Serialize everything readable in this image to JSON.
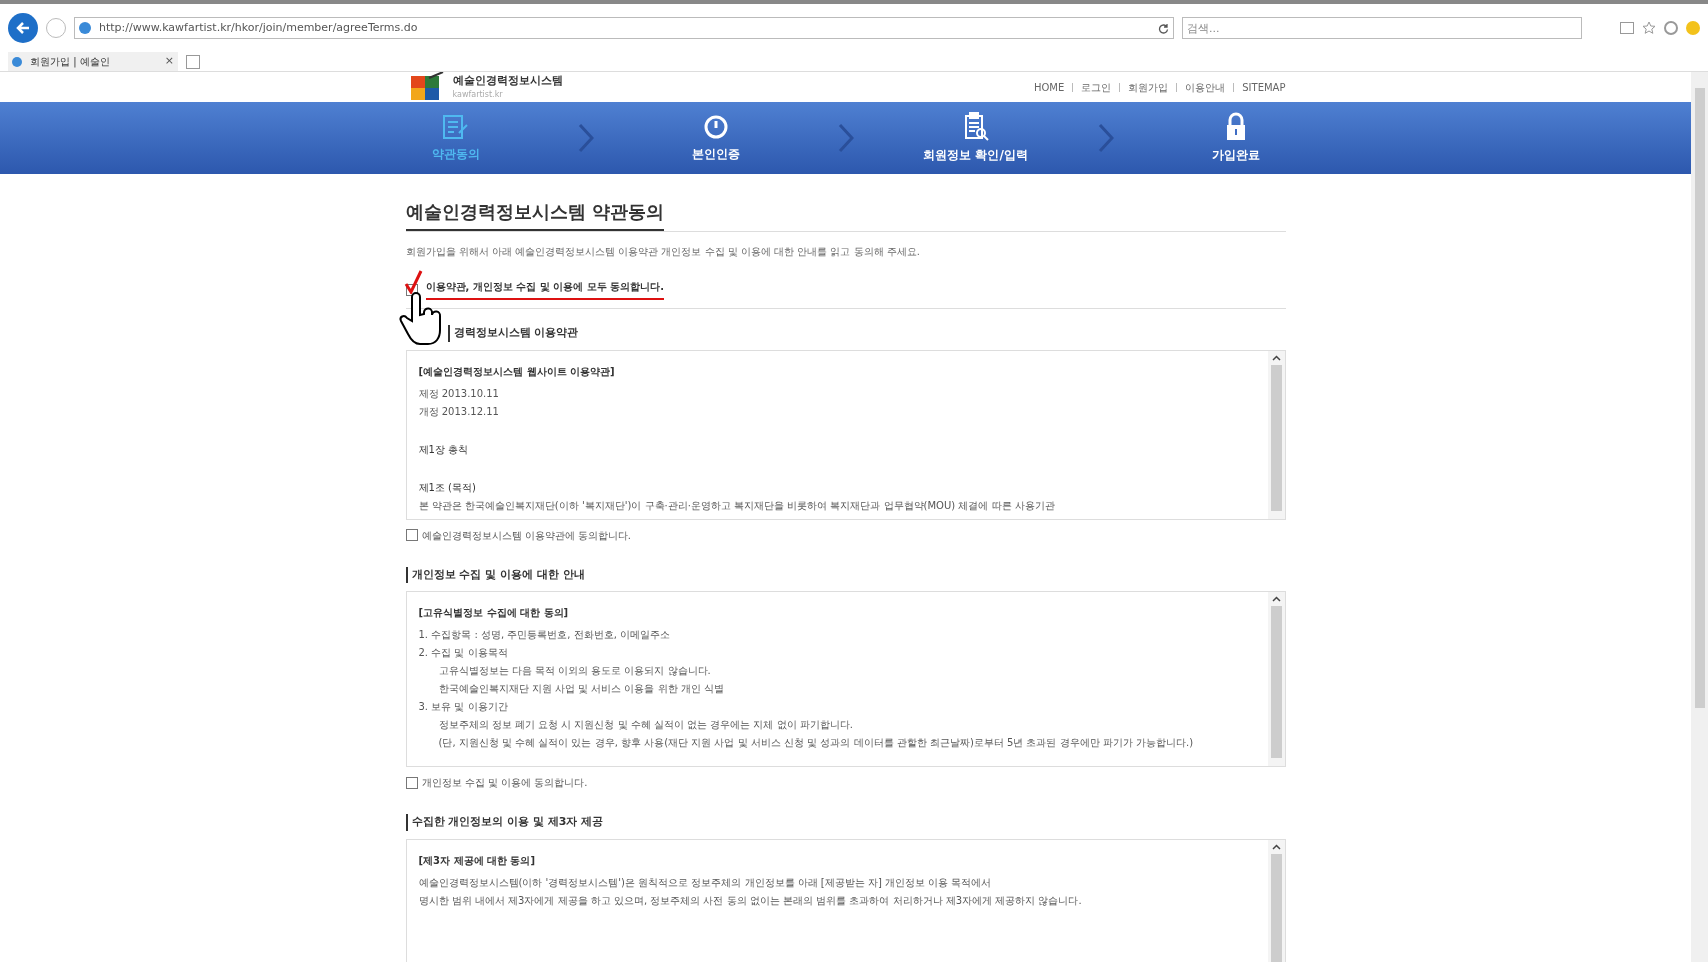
{
  "browser": {
    "url": "http://www.kawfartist.kr/hkor/join/member/agreeTerms.do",
    "search": {
      "placeholder": "검색..."
    },
    "tab": {
      "title": "회원가입 | 예술인",
      "close": "×"
    }
  },
  "header": {
    "logo_title": "예술인경력정보시스템",
    "logo_sub": "kawfartist.kr",
    "menu": [
      "HOME",
      "로그인",
      "회원가입",
      "이용안내",
      "SITEMAP"
    ]
  },
  "steps": [
    {
      "label": "약관동의",
      "selected": true
    },
    {
      "label": "본인인증",
      "selected": false
    },
    {
      "label": "회원정보 확인/입력",
      "selected": false
    },
    {
      "label": "가입완료",
      "selected": false
    }
  ],
  "page_title": "예술인경력정보시스템 약관동의",
  "intro": "회원가입을 위해서 아래 예술인경력정보시스템 이용약관 개인정보 수집 및 이용에 대한 안내를 읽고 동의해 주세요.",
  "agree_all": {
    "label": "이용약관, 개인정보 수집 및 이용에 모두 동의합니다.",
    "checked": true
  },
  "sections": [
    {
      "title": "경력정보시스템 이용약관",
      "agree": {
        "label": "예술인경력정보시스템 이용약관에 동의합니다.",
        "checked": false
      },
      "lines": [
        {
          "kind": "head",
          "text": "[예술인경력정보시스템 웹사이트 이용약관]"
        },
        {
          "kind": "line",
          "text": "제정 2013.10.11"
        },
        {
          "kind": "line",
          "text": "개정 2013.12.11"
        },
        {
          "kind": "chapter",
          "text": "제1장 총칙"
        },
        {
          "kind": "chapter",
          "text": "제1조 (목적)"
        },
        {
          "kind": "line",
          "text": "본 약관은 한국예술인복지재단(이하 '복지재단')이 구축·관리·운영하고 복지재단을 비롯하여 복지재단과 업무협약(MOU) 체결에 따른 사용기관"
        }
      ]
    },
    {
      "title": "개인정보 수집 및 이용에 대한 안내",
      "agree": {
        "label": "개인정보 수집 및 이용에 동의합니다.",
        "checked": false
      },
      "lines": [
        {
          "kind": "head",
          "text": "[고유식별정보 수집에 대한 동의]"
        },
        {
          "kind": "line",
          "text": "1. 수집항목 : 성명, 주민등록번호, 전화번호, 이메일주소"
        },
        {
          "kind": "line",
          "text": "2. 수집 및 이용목적"
        },
        {
          "kind": "sub",
          "text": "고유식별정보는 다음 목적 이외의 용도로 이용되지 않습니다."
        },
        {
          "kind": "sub",
          "text": "한국예술인복지재단 지원 사업 및 서비스 이용을 위한 개인 식별"
        },
        {
          "kind": "line",
          "text": "3. 보유 및 이용기간"
        },
        {
          "kind": "sub",
          "text": "정보주체의 정보 폐기 요청 시 지원신청 및 수혜 실적이 없는 경우에는 지체 없이 파기합니다."
        },
        {
          "kind": "sub",
          "text": "(단, 지원신청 및 수혜 실적이 있는 경우, 향후 사용(재단 지원 사업 및 서비스 신청 및 성과의 데이터를 관할한 최근날짜)로부터 5년 초과된 경우에만 파기가 가능합니다.)"
        }
      ]
    },
    {
      "title": "수집한 개인정보의 이용 및 제3자 제공",
      "lines": [
        {
          "kind": "head",
          "text": "[제3자 제공에 대한 동의]"
        },
        {
          "kind": "line",
          "text": "예술인경력정보시스템(이하 '경력정보시스템')은 원칙적으로 정보주체의 개인정보를 아래 [제공받는 자] 개인정보 이용 목적에서"
        },
        {
          "kind": "line",
          "text": "명시한 범위 내에서 제3자에게 제공을 하고 있으며, 정보주체의 사전 동의 없이는 본래의 범위를 초과하여 처리하거나 제3자에게 제공하지 않습니다."
        }
      ]
    }
  ]
}
